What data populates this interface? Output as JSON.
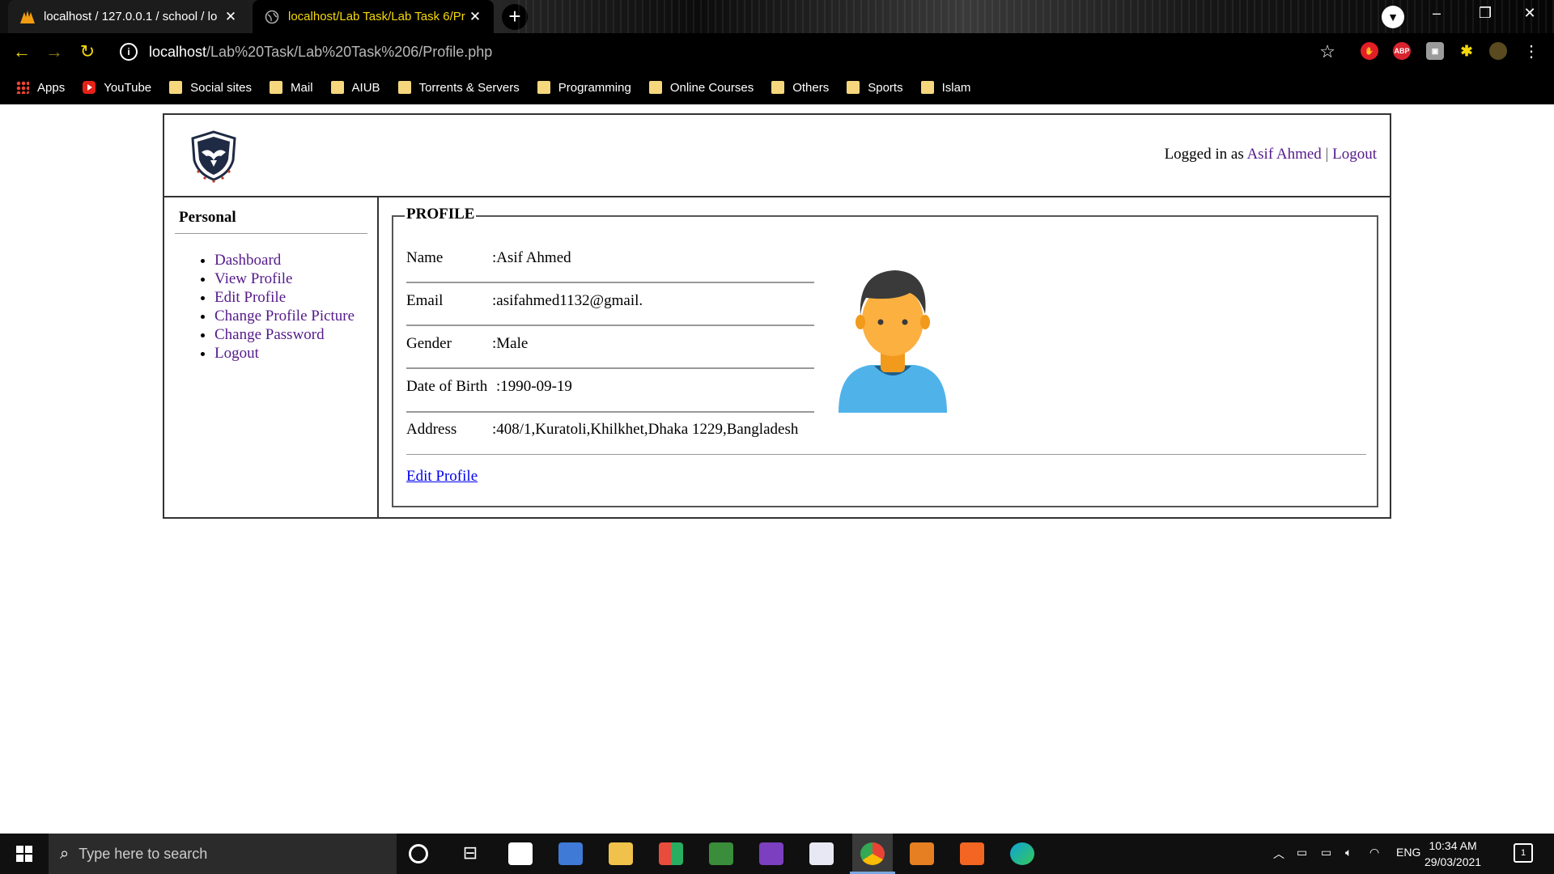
{
  "browser": {
    "tabs": [
      {
        "title": "localhost / 127.0.0.1 / school / lo",
        "active": false
      },
      {
        "title": "localhost/Lab Task/Lab Task 6/Pr",
        "active": true
      }
    ],
    "url_host": "localhost",
    "url_path": "/Lab%20Task/Lab%20Task%206/Profile.php",
    "bookmarks": [
      "Apps",
      "YouTube",
      "Social sites",
      "Mail",
      "AIUB",
      "Torrents & Servers",
      "Programming",
      "Online Courses",
      "Others",
      "Sports",
      "Islam"
    ],
    "extensions": {
      "abp": "ABP"
    }
  },
  "header": {
    "logged_in_prefix": "Logged in as",
    "user_name": "Asif Ahmed",
    "separator": "|",
    "logout": "Logout"
  },
  "sidebar": {
    "title": "Personal",
    "items": [
      "Dashboard",
      "View Profile",
      "Edit Profile",
      "Change Profile Picture",
      "Change Password",
      "Logout"
    ]
  },
  "profile": {
    "legend": "PROFILE",
    "fields": [
      {
        "label": "Name",
        "value": ":Asif Ahmed"
      },
      {
        "label": "Email",
        "value": ":asifahmed1132@gmail."
      },
      {
        "label": "Gender",
        "value": ":Male"
      },
      {
        "label": "Date of Birth",
        "value": ":1990-09-19"
      },
      {
        "label": "Address",
        "value": ":408/1,Kuratoli,Khilkhet,Dhaka 1229,Bangladesh"
      }
    ],
    "edit_link": "Edit Profile"
  },
  "taskbar": {
    "search_placeholder": "Type here to search",
    "language": "ENG",
    "time": "10:34 AM",
    "date": "29/03/2021",
    "notification_count": "1"
  },
  "colors": {
    "link": "#551a8b",
    "active_tab_text": "#f5d90a",
    "avatar_skin": "#fbb040",
    "avatar_shirt": "#4fb3ea",
    "avatar_hair": "#3a3a3a"
  }
}
